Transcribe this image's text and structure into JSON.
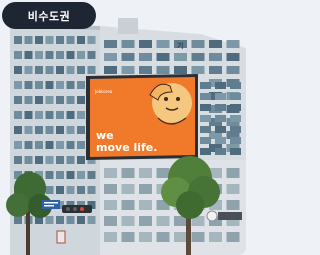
{
  "badge": {
    "label": "비수도권"
  },
  "billboard": {
    "brand": "Jobkorea",
    "slogan_line1": "we",
    "slogan_line2": "move life."
  },
  "building_sign": {
    "text": "기"
  },
  "street_sign": {
    "text": ""
  },
  "colors": {
    "billboard_orange": "#f07a2a",
    "badge_bg": "#1f2633",
    "sky": "#eef2f6"
  }
}
